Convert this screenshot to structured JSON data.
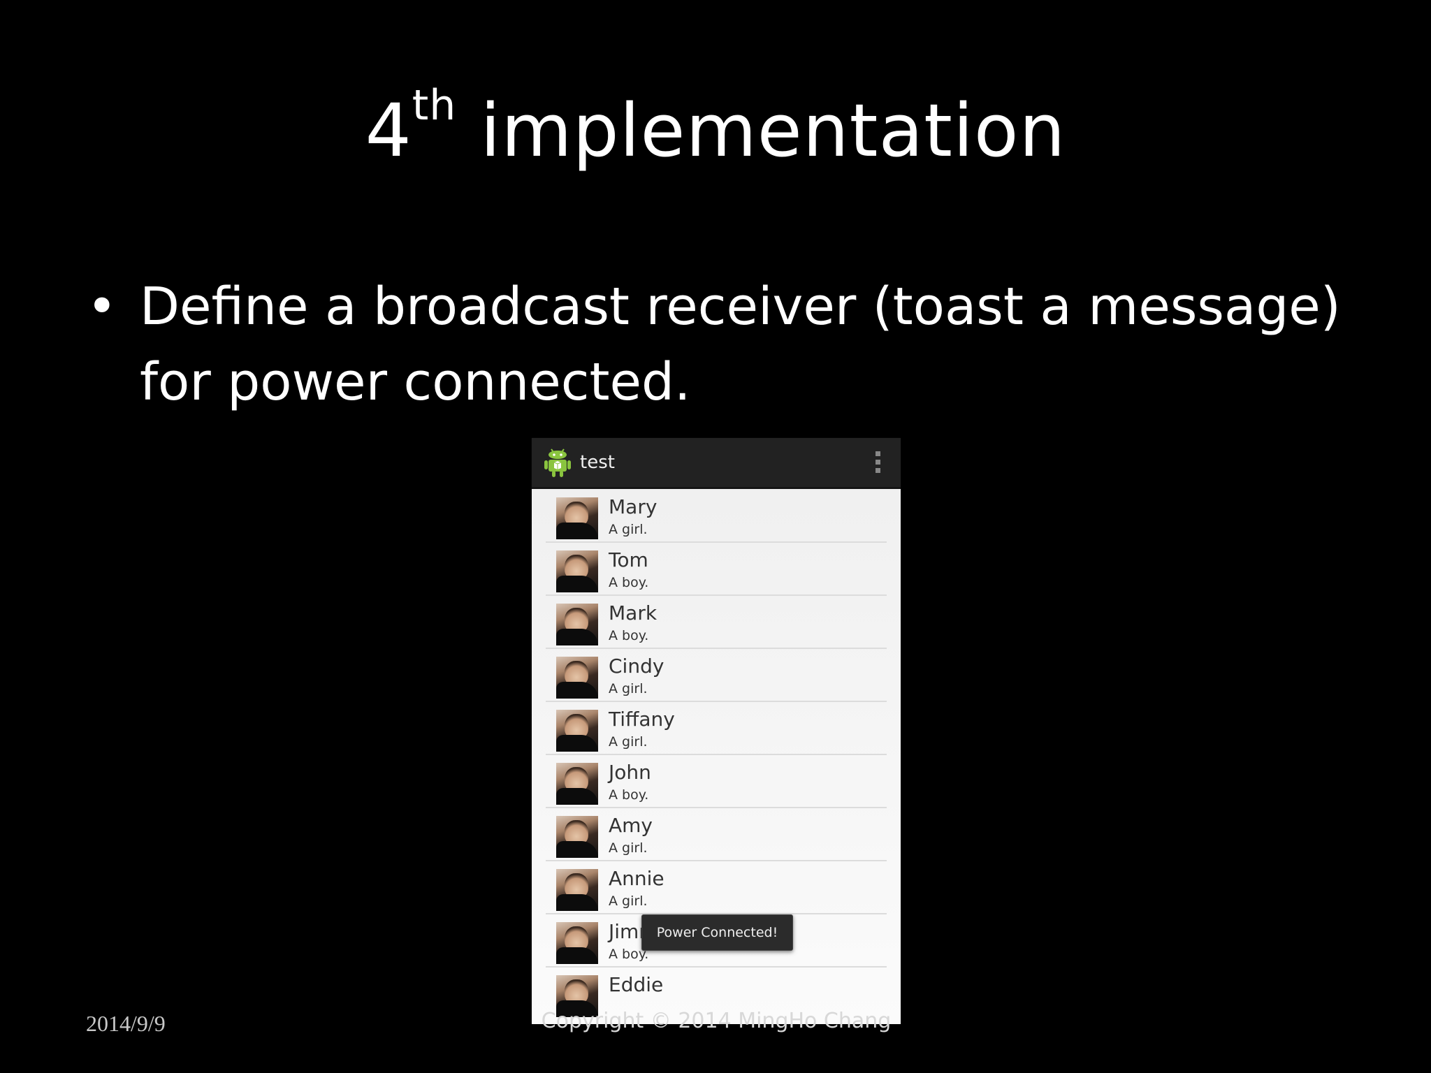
{
  "slide": {
    "title_number": "4",
    "title_superscript": "th",
    "title_rest": " implementation",
    "bullet_symbol": "•",
    "bullet_text": "Define a broadcast receiver (toast a message) for power connected.",
    "footer_date": "2014/9/9",
    "footer_copyright": "Copyright © 2014 MingHo Chang"
  },
  "phone": {
    "app_title": "test",
    "app_icon": "android-robot-icon",
    "menu_icon": "overflow-menu-icon",
    "list": [
      {
        "name": "Mary",
        "desc": "A girl."
      },
      {
        "name": "Tom",
        "desc": "A boy."
      },
      {
        "name": "Mark",
        "desc": "A boy."
      },
      {
        "name": "Cindy",
        "desc": "A girl."
      },
      {
        "name": "Tiffany",
        "desc": "A girl."
      },
      {
        "name": "John",
        "desc": "A boy."
      },
      {
        "name": "Amy",
        "desc": "A girl."
      },
      {
        "name": "Annie",
        "desc": "A girl."
      },
      {
        "name": "Jimmy",
        "desc": "A boy."
      },
      {
        "name": "Eddie",
        "desc": ""
      }
    ],
    "toast": "Power Connected!"
  },
  "colors": {
    "background": "#000000",
    "text": "#ffffff",
    "action_bar": "#222222",
    "list_background": "#f4f4f4",
    "android_green": "#8ac43f"
  }
}
